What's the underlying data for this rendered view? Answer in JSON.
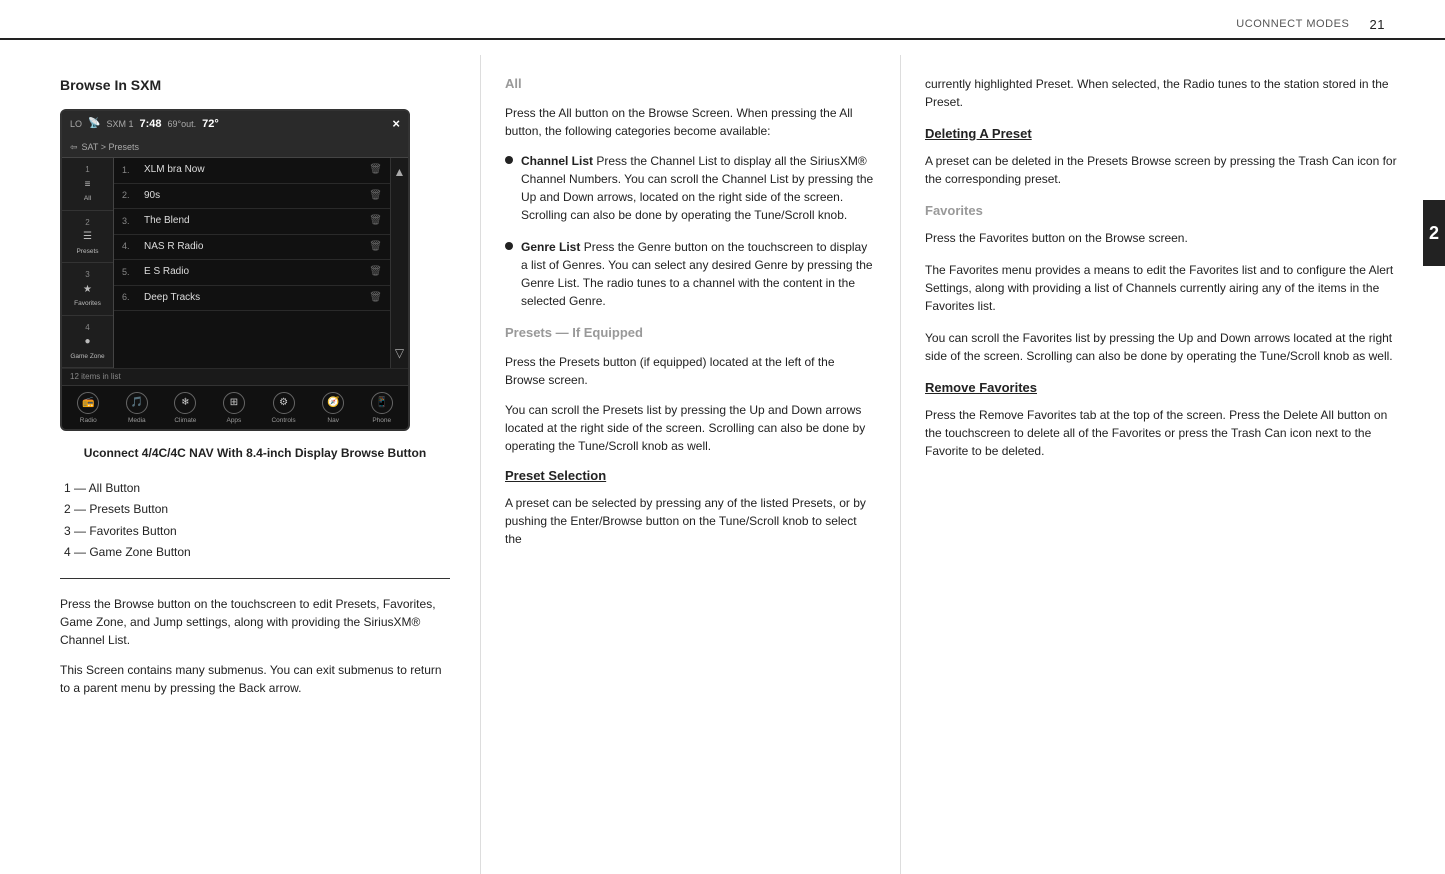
{
  "header": {
    "section_label": "UCONNECT MODES",
    "page_number": "21"
  },
  "side_tab": {
    "number": "2"
  },
  "left_column": {
    "section_title": "Browse In SXM",
    "device": {
      "top_bar": {
        "lo": "LO",
        "satellite_icon": "📡",
        "sat_label": "SXM 1",
        "time": "7:48",
        "temp_out": "69°out.",
        "temp": "72°",
        "close": "×"
      },
      "nav_bar": {
        "back_arrow": "⇦",
        "path": "SAT > Presets"
      },
      "sidebar_items": [
        {
          "number": "1",
          "icon": "≡",
          "label": "All"
        },
        {
          "number": "2",
          "icon": "—",
          "label": "Presets"
        },
        {
          "number": "3",
          "icon": "★",
          "label": "Favorites"
        },
        {
          "number": "4",
          "icon": "●",
          "label": "Game Zone"
        }
      ],
      "list_items": [
        {
          "number": "1.",
          "name": "XLM  bra Now",
          "has_trash": true
        },
        {
          "number": "2.",
          "name": "90s",
          "has_trash": true
        },
        {
          "number": "3.",
          "name": "The Blend",
          "has_trash": true
        },
        {
          "number": "4.",
          "name": "NAS  R Radio",
          "has_trash": true
        },
        {
          "number": "5.",
          "name": "E S   Radio",
          "has_trash": true
        },
        {
          "number": "6.",
          "name": "Deep Tracks",
          "has_trash": true
        }
      ],
      "items_count": "12 items in list",
      "bottom_buttons": [
        {
          "icon": "📻",
          "label": "Radio"
        },
        {
          "icon": "🎵",
          "label": "Media"
        },
        {
          "icon": "❄",
          "label": "Climate"
        },
        {
          "icon": "⚙",
          "label": "Apps"
        },
        {
          "icon": "🕹",
          "label": "Controls"
        },
        {
          "icon": "🧭",
          "label": "Nav"
        },
        {
          "icon": "📱",
          "label": "Phone"
        }
      ]
    },
    "caption": "Uconnect 4/4C/4C NAV With 8.4-inch Display Browse Button",
    "numbered_list": [
      "1 — All Button",
      "2 — Presets Button",
      "3 — Favorites Button",
      "4 — Game Zone Button"
    ],
    "body_paragraphs": [
      "Press the Browse button on the touchscreen to edit Presets, Favorites, Game Zone, and Jump settings, along with providing the SiriusXM® Channel List.",
      "This Screen contains many submenus. You can exit submenus to return to a parent menu by pressing the Back arrow."
    ]
  },
  "middle_column": {
    "subsections": [
      {
        "title": "All",
        "title_style": "gray",
        "body": "Press the All button on the Browse Screen. When pressing the All button, the following categories become available:"
      }
    ],
    "bullets": [
      {
        "label": "Channel List",
        "text": " Press the Channel List to display all the SiriusXM® Channel Numbers. You can scroll the Channel List by pressing the Up and Down arrows, located on the right side of the screen. Scrolling can also be done by operating the Tune/Scroll knob."
      },
      {
        "label": "Genre List",
        "text": " Press the Genre button on the touchscreen to display a list of Genres. You can select any desired Genre by pressing the Genre List. The radio tunes to a channel with the content in the selected Genre."
      }
    ],
    "presets_section": {
      "title": "Presets — If Equipped",
      "title_style": "gray",
      "body": "Press the Presets button (if equipped) located at the left of the Browse screen.",
      "body2": "You can scroll the Presets list by pressing the Up and Down arrows located at the right side of the screen. Scrolling can also be done by operating the Tune/Scroll knob as well."
    },
    "preset_selection": {
      "title": "Preset Selection",
      "title_style": "black",
      "body": "A preset can be selected by pressing any of the listed Presets, or by pushing the Enter/Browse button on the Tune/Scroll knob to select the"
    }
  },
  "right_column": {
    "continuation_text": "currently highlighted Preset. When selected, the Radio tunes to the station stored in the Preset.",
    "subsections": [
      {
        "title": "Deleting A Preset",
        "title_style": "black",
        "body": "A preset can be deleted in the Presets Browse screen by pressing the Trash Can icon for the corresponding preset."
      },
      {
        "title": "Favorites",
        "title_style": "gray",
        "body": "Press the Favorites button on the Browse screen."
      },
      {
        "title": "",
        "title_style": "none",
        "body": "The Favorites menu provides a means to edit the Favorites list and to configure the Alert Settings, along with providing a list of Channels currently airing any of the items in the Favorites list."
      },
      {
        "title": "",
        "title_style": "none",
        "body": "You can scroll the Favorites list by pressing the Up and Down arrows located at the right side of the screen. Scrolling can also be done by operating the Tune/Scroll knob as well."
      },
      {
        "title": "Remove Favorites",
        "title_style": "black",
        "body": "Press the Remove Favorites tab at the top of the screen. Press the Delete All button on the touchscreen to delete all of the Favorites or press the Trash Can icon next to the Favorite to be deleted."
      }
    ]
  }
}
